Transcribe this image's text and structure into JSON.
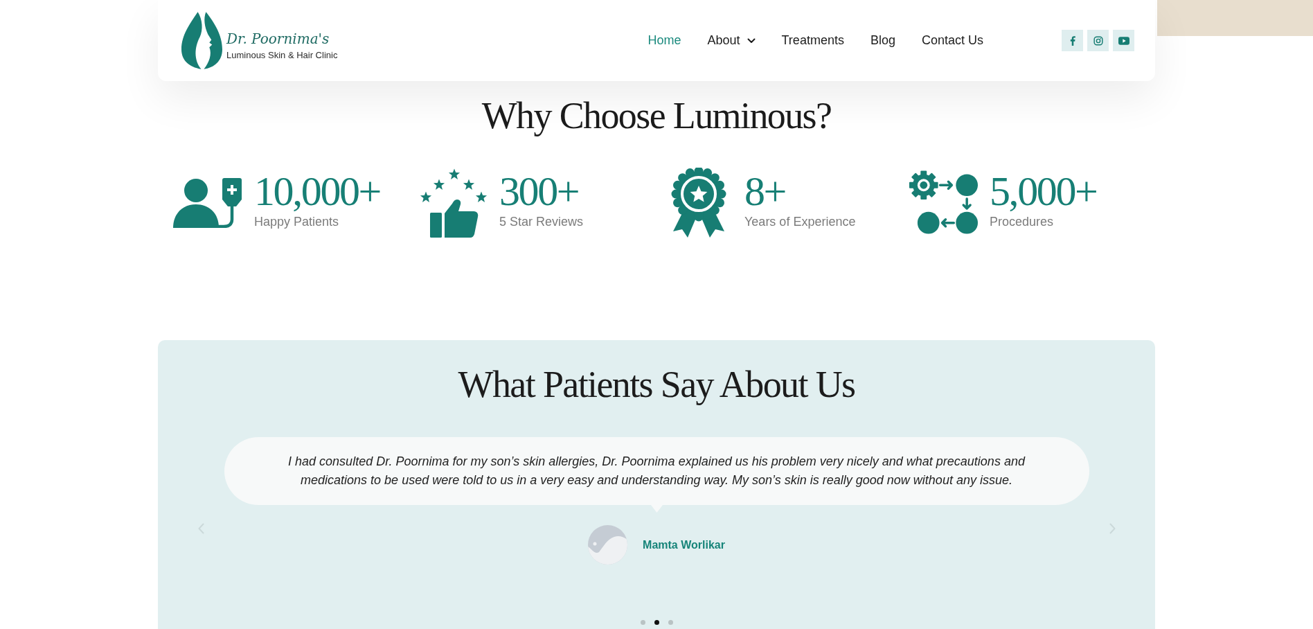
{
  "header": {
    "logo": {
      "name": "Dr. Poornima's",
      "tagline": "Luminous Skin & Hair Clinic"
    },
    "nav": [
      {
        "label": "Home",
        "selected": true,
        "has_dropdown": false
      },
      {
        "label": "About",
        "selected": false,
        "has_dropdown": true
      },
      {
        "label": "Treatments",
        "selected": false,
        "has_dropdown": false
      },
      {
        "label": "Blog",
        "selected": false,
        "has_dropdown": false
      },
      {
        "label": "Contact Us",
        "selected": false,
        "has_dropdown": false
      }
    ],
    "social": [
      {
        "kind": "facebook"
      },
      {
        "kind": "instagram"
      },
      {
        "kind": "youtube"
      }
    ]
  },
  "why_choose": {
    "title": "Why Choose Luminous?",
    "stats": [
      {
        "kind": "patients",
        "value": "10,000+",
        "label": "Happy Patients"
      },
      {
        "kind": "reviews",
        "value": "300+",
        "label": "5 Star Reviews"
      },
      {
        "kind": "award",
        "value": "8+",
        "label": "Years of Experience"
      },
      {
        "kind": "procedures",
        "value": "5,000+",
        "label": "Procedures"
      }
    ]
  },
  "testimonials": {
    "title": "What Patients Say About Us",
    "quote": "I had consulted Dr. Poornima for my son’s skin allergies, Dr. Poornima explained us his problem very nicely and what precautions and medications to be used were told to us in a very easy and understanding way. My son’s skin is really good now without any issue.",
    "author": "Mamta Worlikar",
    "dots": [
      {
        "selected": false
      },
      {
        "selected": true
      },
      {
        "selected": false
      }
    ]
  }
}
